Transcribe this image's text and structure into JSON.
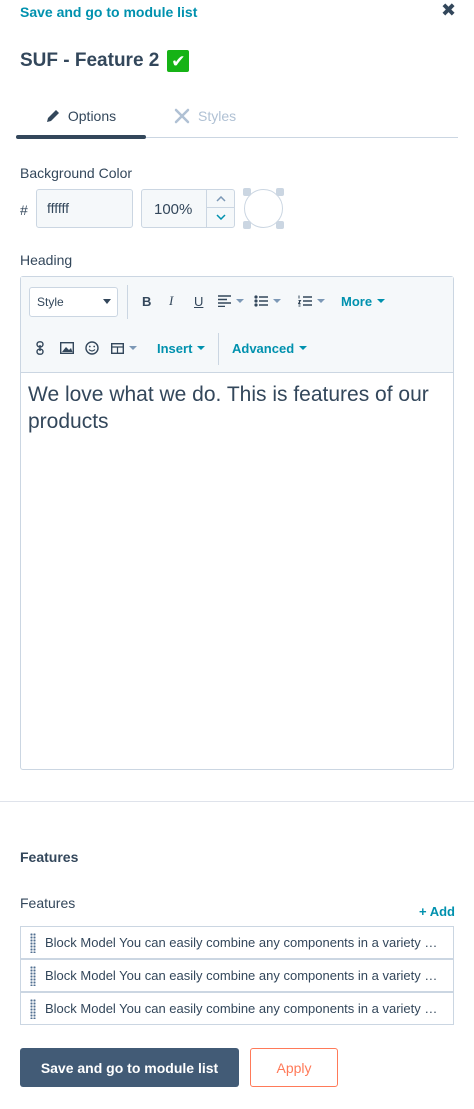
{
  "header": {
    "back_link": "Save and go to module list",
    "close_glyph": "✖",
    "title": "SUF - Feature 2",
    "title_badge": "✔"
  },
  "tabs": [
    {
      "label": "Options",
      "icon": "pencil-icon",
      "active": true
    },
    {
      "label": "Styles",
      "icon": "styles-icon",
      "active": false
    }
  ],
  "background_color": {
    "label": "Background Color",
    "hash": "#",
    "hex_value": "ffffff",
    "opacity": "100%",
    "swatch_color": "#ffffff"
  },
  "heading": {
    "label": "Heading",
    "toolbar": {
      "style_select": "Style",
      "bold": "B",
      "italic": "I",
      "underline": "U",
      "more": "More",
      "insert": "Insert",
      "advanced": "Advanced"
    },
    "content": "We love what we do. This is features of our products"
  },
  "features": {
    "section_title": "Features",
    "list_label": "Features",
    "add_label": "+ Add",
    "items": [
      "Block Model You can easily combine any components in a variety of ways",
      "Block Model You can easily combine any components in a variety of ways",
      "Block Model You can easily combine any components in a variety of ways"
    ]
  },
  "footer": {
    "primary_label": "Save and go to module list",
    "secondary_label": "Apply"
  },
  "colors": {
    "accent": "#0091ae",
    "primary_button": "#425b76",
    "apply_button": "#ff7a59",
    "check_badge": "#16b316"
  }
}
